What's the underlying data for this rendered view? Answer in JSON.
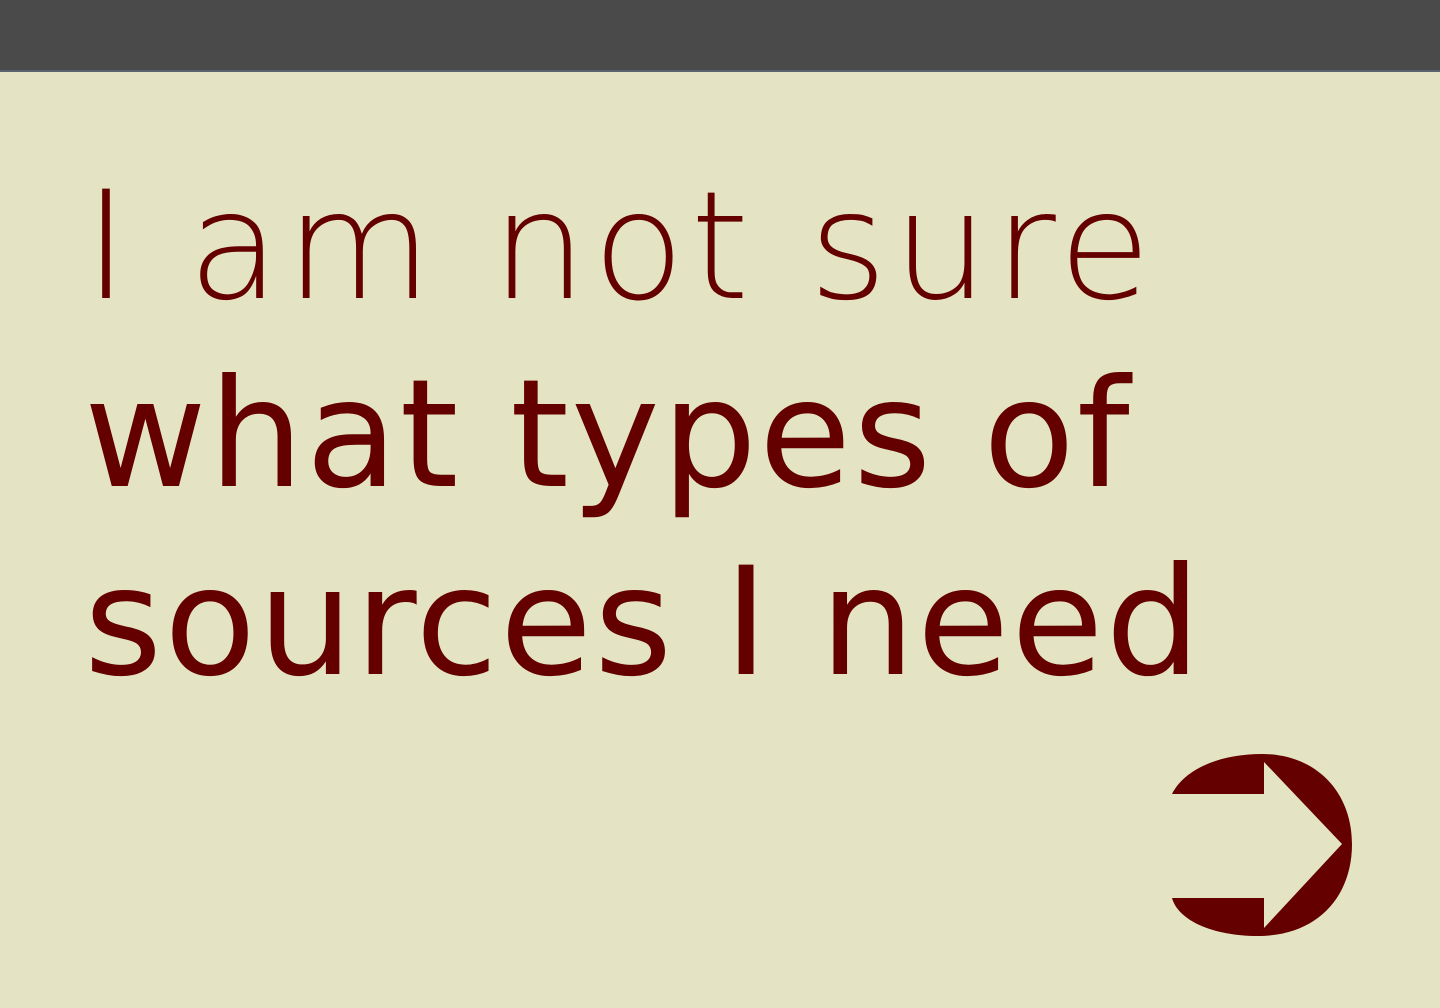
{
  "header": {
    "bar_color": "#4a4a4a"
  },
  "content": {
    "line1": "I am not sure",
    "line2": "what types of",
    "line3": "sources I need",
    "text_color": "#650000",
    "background_color": "#e4e4c4"
  },
  "navigation": {
    "next_icon": "arrow-right-icon"
  }
}
